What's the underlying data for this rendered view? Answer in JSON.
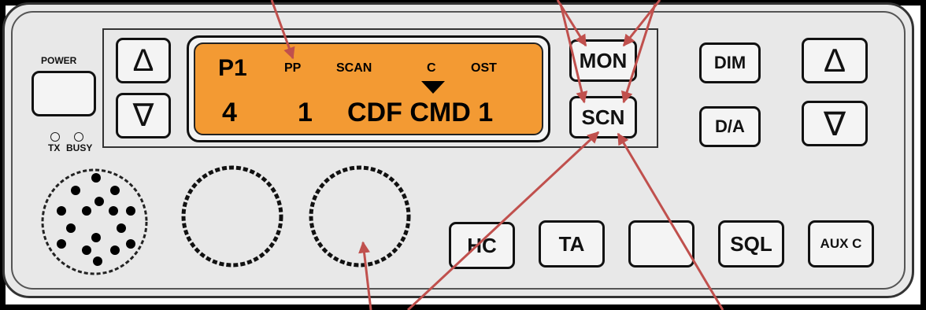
{
  "colors": {
    "lcd": "#f39a33",
    "arrow": "#c0504d",
    "panel": "#e8e8e8"
  },
  "power": {
    "label": "POWER"
  },
  "indicators": {
    "tx": "TX",
    "busy": "BUSY"
  },
  "left_keys": {
    "up": "Δ",
    "down": "∇"
  },
  "right_keys": {
    "up": "Δ",
    "down": "∇"
  },
  "display": {
    "row1": {
      "zone": "P1",
      "pp": "PP",
      "scan": "SCAN",
      "c": "C",
      "ost": "OST"
    },
    "row2": {
      "zone_num": "4",
      "channel_num": "1",
      "channel_name": "CDF CMD 1"
    },
    "pointer_icon": "triangle-down"
  },
  "buttons": {
    "mon": "MON",
    "scn": "SCN",
    "dim": "DIM",
    "da": "D/A",
    "hc": "HC",
    "ta": "TA",
    "blank": "",
    "sql": "SQL",
    "auxc": "AUX C"
  },
  "knobs": [
    "volume-knob",
    "channel-knob"
  ],
  "speaker": {
    "icon": "speaker-grille"
  }
}
